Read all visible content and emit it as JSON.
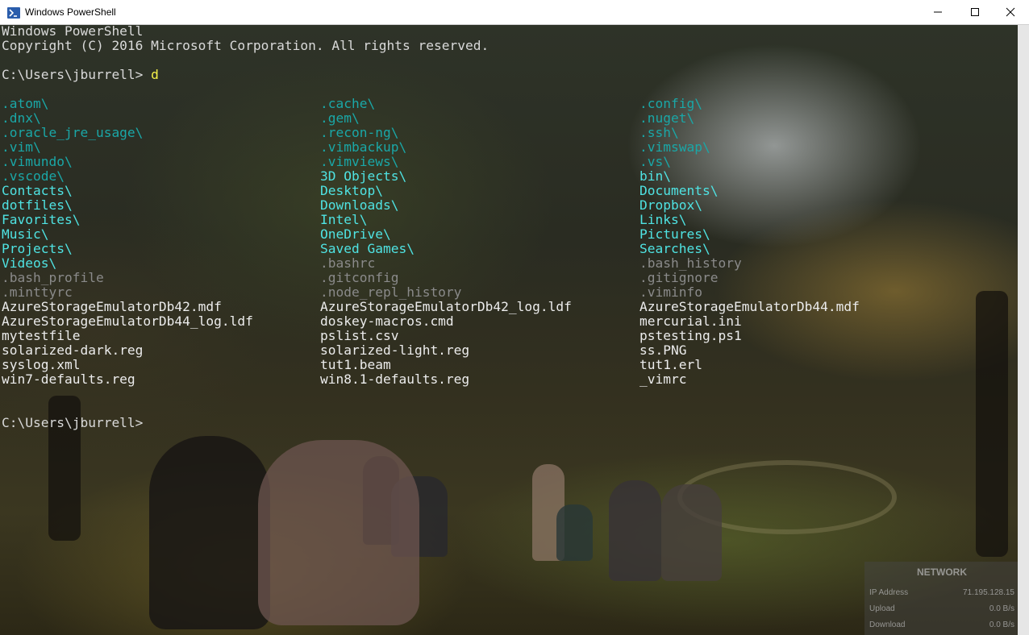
{
  "window": {
    "title": "Windows PowerShell",
    "icon": "powershell-icon",
    "accent": "#012456"
  },
  "console": {
    "header_line1": "Windows PowerShell",
    "header_line2": "Copyright (C) 2016 Microsoft Corporation. All rights reserved.",
    "prompt1": "C:\\Users\\jburrell> ",
    "command": "d",
    "prompt2": "C:\\Users\\jburrell>",
    "listing": [
      [
        "dcyan",
        ".atom\\",
        ".cache\\",
        ".config\\"
      ],
      [
        "dcyan",
        ".dnx\\",
        ".gem\\",
        ".nuget\\"
      ],
      [
        "dcyan",
        ".oracle_jre_usage\\",
        ".recon-ng\\",
        ".ssh\\"
      ],
      [
        "dcyan",
        ".vim\\",
        ".vimbackup\\",
        ".vimswap\\"
      ],
      [
        "dcyan",
        ".vimundo\\",
        ".vimviews\\",
        ".vs\\"
      ],
      [
        "mixed",
        ".vscode\\",
        "3D Objects\\",
        "bin\\"
      ],
      [
        "cyan",
        "Contacts\\",
        "Desktop\\",
        "Documents\\"
      ],
      [
        "cyan",
        "dotfiles\\",
        "Downloads\\",
        "Dropbox\\"
      ],
      [
        "cyan",
        "Favorites\\",
        "Intel\\",
        "Links\\"
      ],
      [
        "cyan",
        "Music\\",
        "OneDrive\\",
        "Pictures\\"
      ],
      [
        "cyan",
        "Projects\\",
        "Saved Games\\",
        "Searches\\"
      ],
      [
        "mixed2",
        "Videos\\",
        ".bashrc",
        ".bash_history"
      ],
      [
        "gray",
        ".bash_profile",
        ".gitconfig",
        ".gitignore"
      ],
      [
        "gray",
        ".minttyrc",
        ".node_repl_history",
        ".viminfo"
      ],
      [
        "file",
        "AzureStorageEmulatorDb42.mdf",
        "AzureStorageEmulatorDb42_log.ldf",
        "AzureStorageEmulatorDb44.mdf"
      ],
      [
        "file",
        "AzureStorageEmulatorDb44_log.ldf",
        "doskey-macros.cmd",
        "mercurial.ini"
      ],
      [
        "file",
        "mytestfile",
        "pslist.csv",
        "pstesting.ps1"
      ],
      [
        "file",
        "solarized-dark.reg",
        "solarized-light.reg",
        "ss.PNG"
      ],
      [
        "file",
        "syslog.xml",
        "tut1.beam",
        "tut1.erl"
      ],
      [
        "file",
        "win7-defaults.reg",
        "win8.1-defaults.reg",
        "_vimrc"
      ]
    ]
  },
  "network_widget": {
    "title": "NETWORK",
    "ip_label": "IP Address",
    "ip_value": "71.195.128.15",
    "upload_label": "Upload",
    "upload_value": "0.0 B/s",
    "download_label": "Download",
    "download_value": "0.0 B/s"
  },
  "colors": {
    "prompt_text": "#d9d9d9",
    "command_text": "#f5f24a",
    "directory": "#4fe3e3",
    "hidden_directory": "#1aa7a7",
    "hidden_file": "#8a8a8a",
    "file": "#ececec"
  }
}
